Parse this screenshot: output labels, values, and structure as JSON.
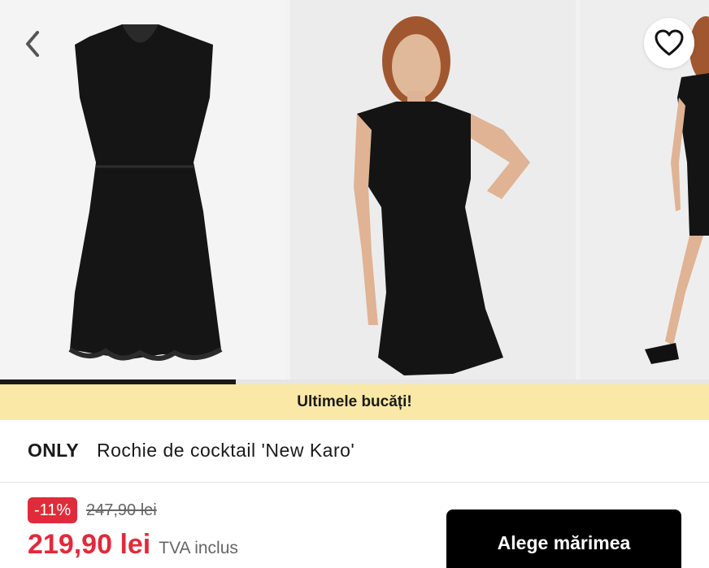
{
  "gallery": {
    "images": [
      {
        "icon": "dress-product-image"
      },
      {
        "icon": "model-front-image"
      },
      {
        "icon": "model-side-image"
      }
    ],
    "progress": 0.333
  },
  "header": {
    "back_icon": "chevron-left-icon",
    "favorite_icon": "heart-icon"
  },
  "banner": {
    "text": "Ultimele bucăți!",
    "color": "#fae9a6"
  },
  "product": {
    "brand": "ONLY",
    "name": "Rochie de cocktail 'New Karo'"
  },
  "pricing": {
    "discount": "-11%",
    "old_price": "247,90 lei",
    "price": "219,90 lei",
    "vat_note": "TVA inclus",
    "accent": "#e02b3a"
  },
  "cta": {
    "label": "Alege mărimea"
  }
}
